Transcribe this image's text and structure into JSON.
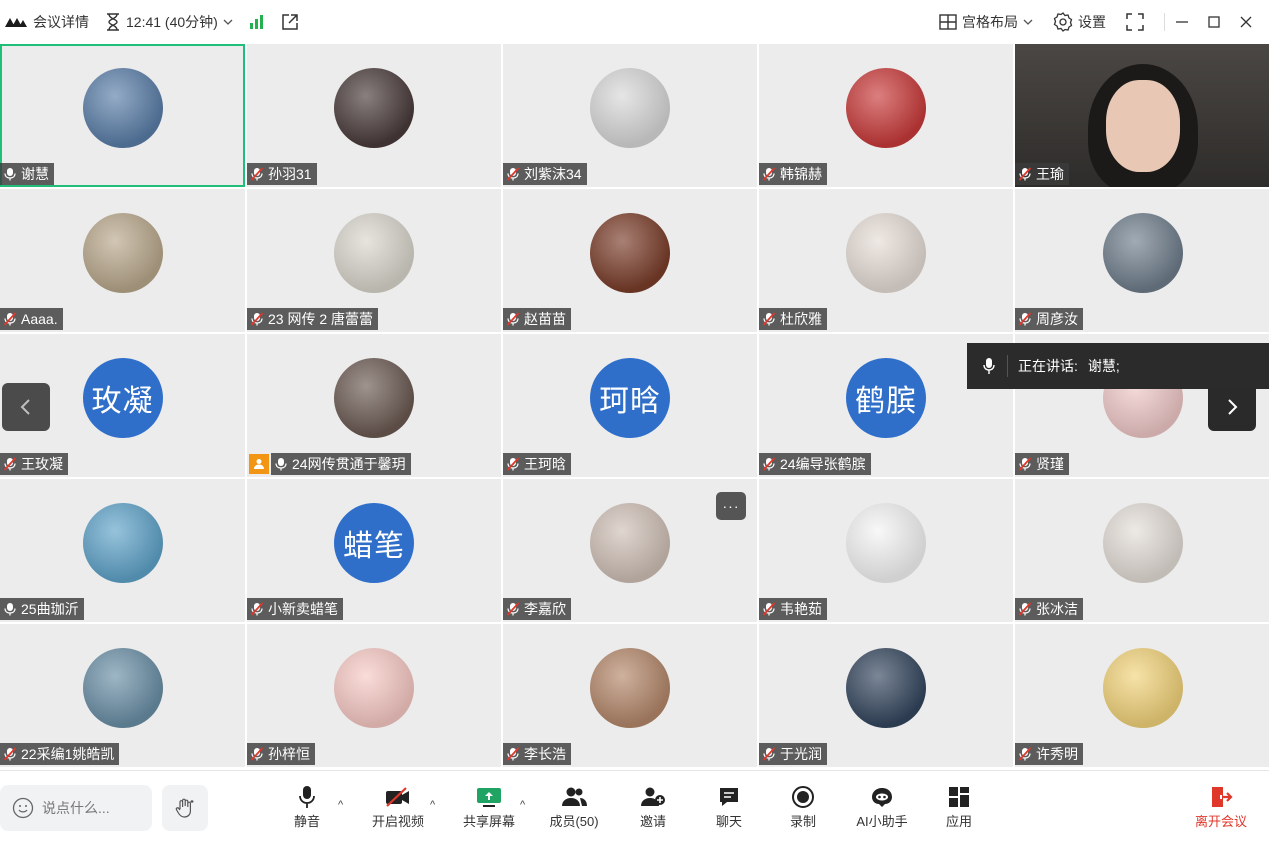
{
  "topbar": {
    "meeting_details": "会议详情",
    "timer": "12:41 (40分钟)",
    "layout": "宫格布局",
    "settings": "设置"
  },
  "tiles": [
    {
      "name": "谢慧",
      "mic": "on",
      "avatar": "photo",
      "color": "#5a7ea8",
      "active": true
    },
    {
      "name": "孙羽31",
      "mic": "muted",
      "avatar": "photo",
      "color": "#4a3b3b"
    },
    {
      "name": "刘紫沫34",
      "mic": "muted",
      "avatar": "photo",
      "color": "#d8d8d8"
    },
    {
      "name": "韩锦赫",
      "mic": "muted",
      "avatar": "photo",
      "color": "#c93a3a"
    },
    {
      "name": "王瑜",
      "mic": "muted",
      "avatar": "video",
      "color": "#3a3836"
    },
    {
      "name": "Aaaa.",
      "mic": "muted",
      "avatar": "photo",
      "color": "#b9a88c"
    },
    {
      "name": "23 网传 2 唐蕾蕾",
      "mic": "muted",
      "avatar": "photo",
      "color": "#d9d6cc"
    },
    {
      "name": "赵苗苗",
      "mic": "muted",
      "avatar": "photo",
      "color": "#7a3d2a"
    },
    {
      "name": "杜欣雅",
      "mic": "muted",
      "avatar": "photo",
      "color": "#e6ddd6"
    },
    {
      "name": "周彦汝",
      "mic": "muted",
      "avatar": "photo",
      "color": "#6f7e8c"
    },
    {
      "name": "王玫凝",
      "mic": "muted",
      "avatar": "text",
      "text": "玫凝"
    },
    {
      "name": "24网传贯通于馨玥",
      "mic": "on",
      "avatar": "photo",
      "color": "#6b5a52",
      "host": true
    },
    {
      "name": "王珂晗",
      "mic": "muted",
      "avatar": "text",
      "text": "珂晗"
    },
    {
      "name": "24编导张鹤膑",
      "mic": "muted",
      "avatar": "text",
      "text": "鹤膑"
    },
    {
      "name": "贤瑾",
      "mic": "muted",
      "avatar": "photo",
      "color": "#f0c8c8"
    },
    {
      "name": "25曲珈沂",
      "mic": "on",
      "avatar": "photo",
      "color": "#5fa3c9"
    },
    {
      "name": "小新卖蜡笔",
      "mic": "muted",
      "avatar": "text",
      "text": "蜡笔"
    },
    {
      "name": "李嘉欣",
      "mic": "muted",
      "avatar": "photo",
      "color": "#cfc0b6"
    },
    {
      "name": "韦艳茹",
      "mic": "muted",
      "avatar": "photo",
      "color": "#f4f4f4"
    },
    {
      "name": "张冰洁",
      "mic": "muted",
      "avatar": "photo",
      "color": "#e3ddd6"
    },
    {
      "name": "22采编1姚皓凯",
      "mic": "muted",
      "avatar": "photo",
      "color": "#6a8fa6"
    },
    {
      "name": "孙梓恒",
      "mic": "muted",
      "avatar": "photo",
      "color": "#f7c9c4"
    },
    {
      "name": "李长浩",
      "mic": "muted",
      "avatar": "photo",
      "color": "#b4876a"
    },
    {
      "name": "于光润",
      "mic": "muted",
      "avatar": "photo",
      "color": "#34465e"
    },
    {
      "name": "许秀明",
      "mic": "muted",
      "avatar": "photo",
      "color": "#f2d37a"
    }
  ],
  "speaking": {
    "label": "正在讲话:",
    "name": "谢慧;"
  },
  "more_dots": "···",
  "bottombar": {
    "chat_placeholder": "说点什么...",
    "mute": "静音",
    "start_video": "开启视频",
    "share_screen": "共享屏幕",
    "members": "成员(50)",
    "invite": "邀请",
    "chat": "聊天",
    "record": "录制",
    "ai_assistant": "AI小助手",
    "apps": "应用",
    "leave": "离开会议"
  },
  "colors": {
    "accent_green": "#1fbf7a",
    "leave_red": "#e0372b",
    "text_avatar_blue": "#2f6fca",
    "host_orange": "#f29512"
  }
}
